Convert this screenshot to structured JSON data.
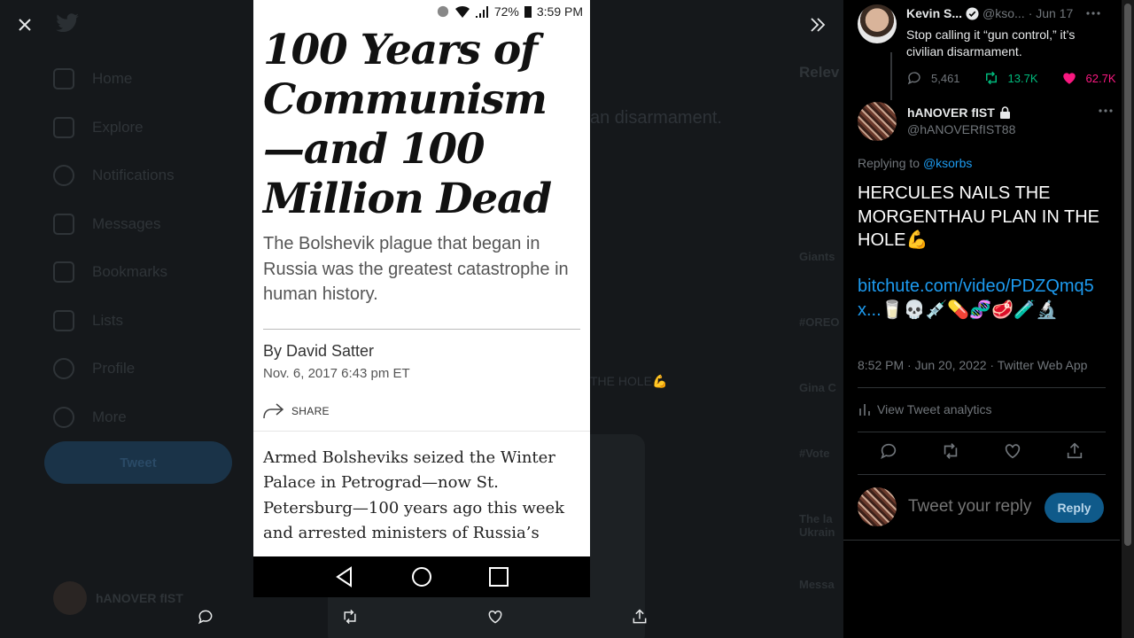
{
  "background": {
    "nav_items": [
      "Home",
      "Explore",
      "Notifications",
      "Messages",
      "Bookmarks",
      "Lists",
      "Profile",
      "More"
    ],
    "tweet_button": "Tweet",
    "account_name": "hANOVER fIST",
    "main_fragment": "an disarmament.",
    "hole_fragment": "THE HOLE💪",
    "right_heading": "Relev",
    "right_items": [
      "Giants",
      "#OREO",
      "Gina C",
      "#Vote",
      "The la Ukrain",
      "Messa"
    ]
  },
  "phone": {
    "status": {
      "battery": "72%",
      "time": "3:59 PM"
    },
    "article": {
      "title": "100 Years of Communism—and 100 Million Dead",
      "subtitle": "The Bolshevik plague that began in Russia was the greatest catastrophe in human history.",
      "byline": "By David Satter",
      "date": "Nov. 6, 2017 6:43 pm ET",
      "share_label": "SHARE",
      "body": "Armed Bolsheviks seized the Winter Palace in Petrograd—now St. Petersburg—100 years ago this week and arrested ministers of Russia’s"
    }
  },
  "panel": {
    "parent_tweet": {
      "name": "Kevin S...",
      "handle": "@kso...",
      "date": "· Jun 17",
      "text": "Stop calling it “gun control,” it’s civilian disarmament.",
      "replies": "5,461",
      "retweets": "13.7K",
      "likes": "62.7K"
    },
    "tweet": {
      "name": "hANOVER fIST",
      "handle": "@hANOVERfIST88",
      "replying_label": "Replying to ",
      "replying_to": "@ksorbs",
      "text": "HERCULES NAILS THE MORGENTHAU PLAN IN THE HOLE💪",
      "link": "bitchute.com/video/PDZQmq5x...",
      "emojis": "🥛💀💉💊🧬🥩🧪🔬",
      "timestamp": "8:52 PM · Jun 20, 2022 · Twitter Web App",
      "analytics": "View Tweet analytics"
    },
    "reply": {
      "placeholder": "Tweet your reply",
      "button": "Reply"
    }
  },
  "colors": {
    "accent": "#1d9bf0",
    "like": "#f91880",
    "retweet": "#00ba7c",
    "panel_bg": "#000000"
  }
}
